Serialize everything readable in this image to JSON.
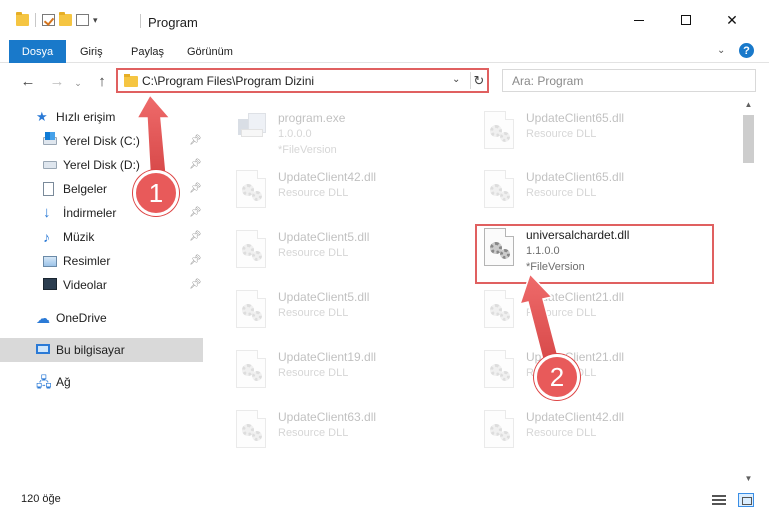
{
  "titlebar": {
    "title": "Program",
    "quick_access": [
      "folder-icon",
      "properties-check-icon",
      "new-folder-icon",
      "customize-icon"
    ],
    "minimize": "minimize",
    "maximize": "maximize",
    "close": "close"
  },
  "ribbon": {
    "file_tab": "Dosya",
    "tabs": [
      "Giriş",
      "Paylaş",
      "Görünüm"
    ],
    "help": "?"
  },
  "address": {
    "path": "C:\\Program Files\\Program Dizini",
    "search_placeholder": "Ara: Program"
  },
  "navpane": {
    "quick_access_label": "Hızlı erişim",
    "pinned": [
      {
        "label": "Yerel Disk (C:)",
        "icon": "drive-windows-icon"
      },
      {
        "label": "Yerel Disk (D:)",
        "icon": "drive-icon"
      },
      {
        "label": "Belgeler",
        "icon": "documents-icon"
      },
      {
        "label": "İndirmeler",
        "icon": "download-icon"
      },
      {
        "label": "Müzik",
        "icon": "music-icon"
      },
      {
        "label": "Resimler",
        "icon": "pictures-icon"
      },
      {
        "label": "Videolar",
        "icon": "videos-icon"
      }
    ],
    "onedrive": "OneDrive",
    "this_pc": "Bu bilgisayar",
    "network": "Ağ"
  },
  "files": {
    "left": [
      {
        "name": "program.exe",
        "line1": "1.0.0.0",
        "line2": "*FileVersion",
        "icon": "exe-icon"
      },
      {
        "name": "UpdateClient42.dll",
        "line1": "Resource DLL",
        "icon": "dll-icon"
      },
      {
        "name": "UpdateClient5.dll",
        "line1": "Resource DLL",
        "icon": "dll-icon"
      },
      {
        "name": "UpdateClient5.dll",
        "line1": "Resource DLL",
        "icon": "dll-icon"
      },
      {
        "name": "UpdateClient19.dll",
        "line1": "Resource DLL",
        "icon": "dll-icon"
      },
      {
        "name": "UpdateClient63.dll",
        "line1": "Resource DLL",
        "icon": "dll-icon"
      }
    ],
    "right": [
      {
        "name": "UpdateClient65.dll",
        "line1": "Resource DLL",
        "icon": "dll-icon"
      },
      {
        "name": "UpdateClient65.dll",
        "line1": "Resource DLL",
        "icon": "dll-icon"
      },
      {
        "name": "universalchardet.dll",
        "line1": "1.1.0.0",
        "line2": "*FileVersion",
        "icon": "dll-icon",
        "highlighted": true
      },
      {
        "name": "UpdateClient21.dll",
        "line1": "Resource DLL",
        "icon": "dll-icon"
      },
      {
        "name": "UpdateClient21.dll",
        "line1": "Resource DLL",
        "icon": "dll-icon"
      },
      {
        "name": "UpdateClient42.dll",
        "line1": "Resource DLL",
        "icon": "dll-icon"
      }
    ]
  },
  "status": {
    "item_count": "120 öğe"
  },
  "annotations": {
    "step1": "1",
    "step2": "2",
    "color": "#e85a5a"
  },
  "colors": {
    "accent": "#1979ca",
    "selection": "#cce8ff",
    "annotation": "#e06060"
  }
}
